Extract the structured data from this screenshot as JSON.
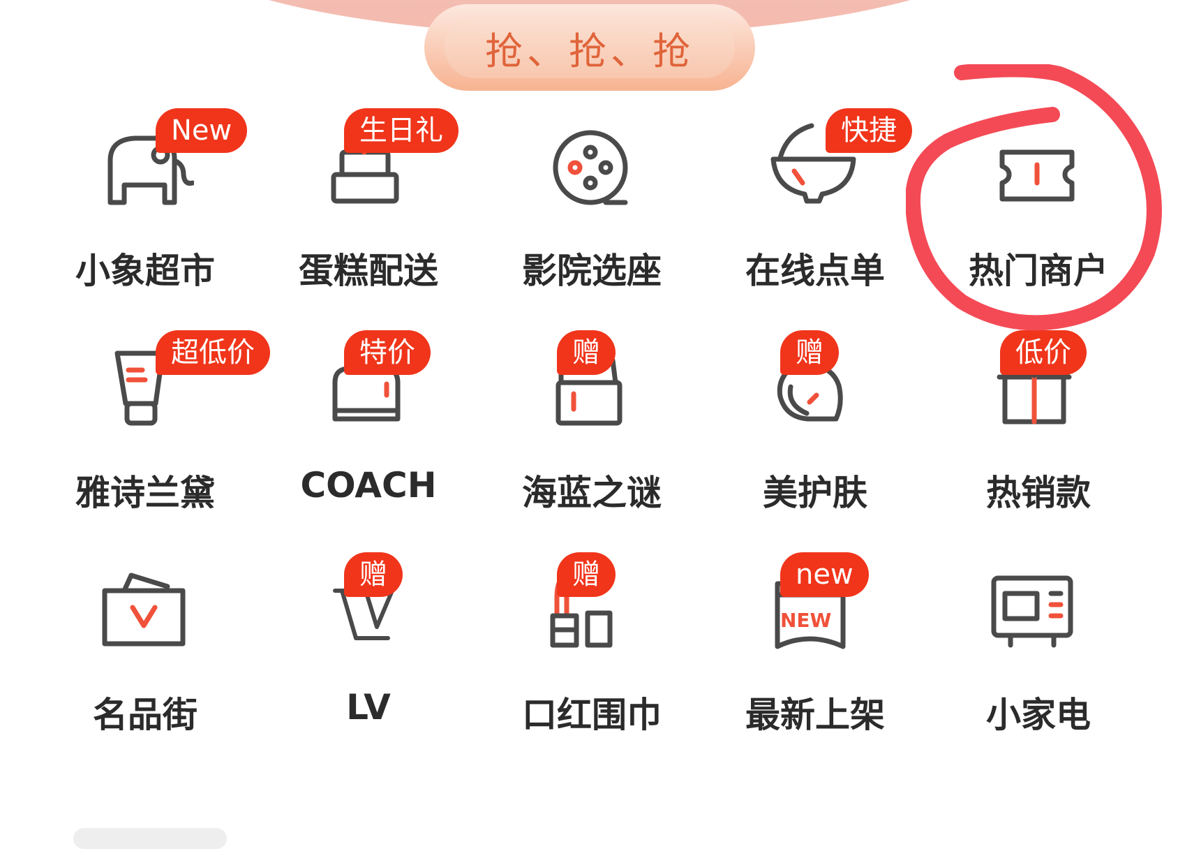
{
  "banner": {
    "title": "抢、抢、抢"
  },
  "items": [
    {
      "label": "小象超市",
      "badge": "New",
      "icon": "elephant-icon"
    },
    {
      "label": "蛋糕配送",
      "badge": "生日礼",
      "icon": "cake-icon"
    },
    {
      "label": "影院选座",
      "badge": "",
      "icon": "film-reel-icon"
    },
    {
      "label": "在线点单",
      "badge": "快捷",
      "icon": "bowl-icon"
    },
    {
      "label": "热门商户",
      "badge": "",
      "icon": "ticket-icon"
    },
    {
      "label": "雅诗兰黛",
      "badge": "超低价",
      "icon": "cosmetic-tube-icon"
    },
    {
      "label": "COACH",
      "badge": "特价",
      "icon": "handbag-icon"
    },
    {
      "label": "海蓝之谜",
      "badge": "赠",
      "icon": "cream-jar-icon"
    },
    {
      "label": "美护肤",
      "badge": "赠",
      "icon": "face-icon"
    },
    {
      "label": "热销款",
      "badge": "低价",
      "icon": "gift-box-icon"
    },
    {
      "label": "名品街",
      "badge": "",
      "icon": "shopping-bag-v-icon"
    },
    {
      "label": "LV",
      "badge": "赠",
      "icon": "lv-logo-icon"
    },
    {
      "label": "口红围巾",
      "badge": "赠",
      "icon": "lipstick-icon"
    },
    {
      "label": "最新上架",
      "badge": "new",
      "icon": "new-tag-icon"
    },
    {
      "label": "小家电",
      "badge": "",
      "icon": "microwave-icon"
    }
  ],
  "colors": {
    "badge": "#f0351b",
    "accent": "#f0513a",
    "icon_stroke": "#4a4a4a",
    "annotation": "#f44a56"
  }
}
